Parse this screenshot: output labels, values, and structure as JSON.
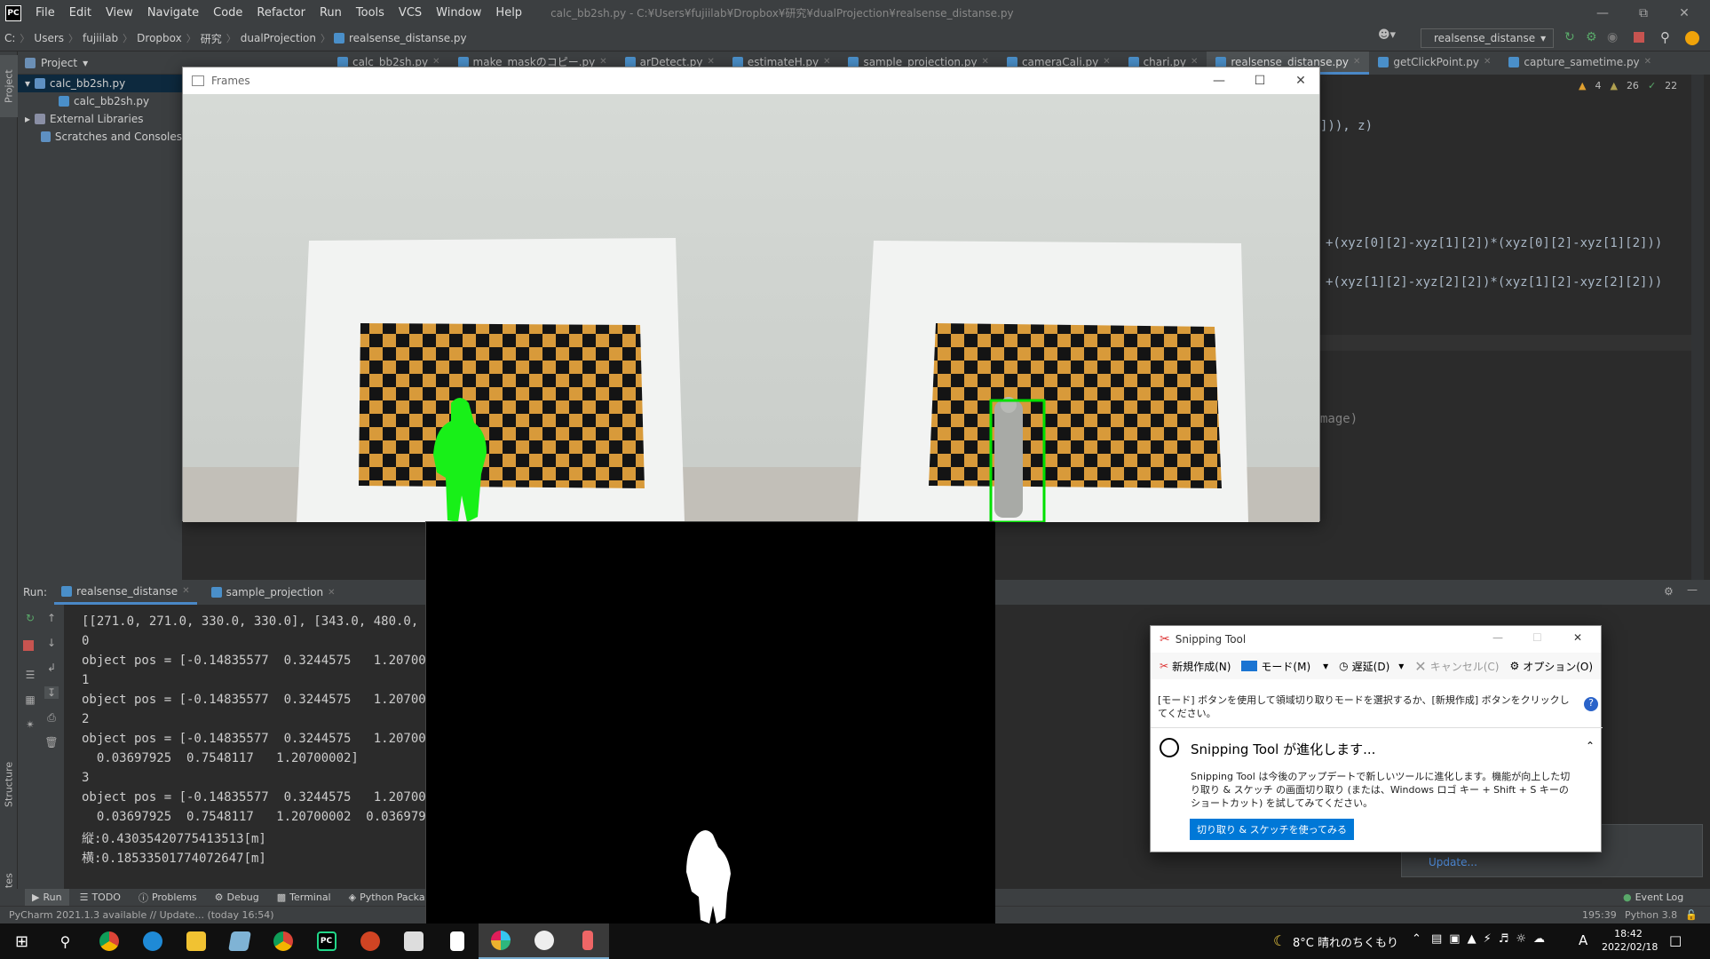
{
  "menubar": {
    "items": [
      "File",
      "Edit",
      "View",
      "Navigate",
      "Code",
      "Refactor",
      "Run",
      "Tools",
      "VCS",
      "Window",
      "Help"
    ],
    "window_title": "calc_bb2sh.py - C:¥Users¥fujiilab¥Dropbox¥研究¥dualProjection¥realsense_distanse.py"
  },
  "navbar": {
    "crumbs": [
      "C:",
      "Users",
      "fujiilab",
      "Dropbox",
      "研究",
      "dualProjection",
      "realsense_distanse.py"
    ],
    "run_config": "realsense_distanse"
  },
  "project": {
    "header": "Project",
    "root": "calc_bb2sh.py",
    "child": "calc_bb2sh.py",
    "ext_libs": "External Libraries",
    "scratches": "Scratches and Consoles"
  },
  "side_tabs": {
    "project": "Project",
    "structure": "Structure",
    "favorites": "Favorites"
  },
  "editor_tabs": [
    "calc_bb2sh.py",
    "make_maskのコピー.py",
    "arDetect.py",
    "estimateH.py",
    "sample_projection.py",
    "cameraCali.py",
    "chari.py",
    "realsense_distanse.py",
    "getClickPoint.py",
    "capture_sametime.py"
  ],
  "active_tab_index": 7,
  "inspections": {
    "warnings": "4",
    "weak": "26",
    "ok": "22"
  },
  "code_fragments": {
    "line1": "])), z)",
    "line2": "+(xyz[0][2]-xyz[1][2])*(xyz[0][2]-xyz[1][2]))",
    "line3": "+(xyz[1][2]-xyz[2][2])*(xyz[1][2]-xyz[2][2]))",
    "line4": "mage)"
  },
  "run": {
    "label": "Run:",
    "tabs": [
      "realsense_distanse",
      "sample_projection"
    ],
    "console": [
      "[[271.0, 271.0, 330.0, 330.0], [343.0, 480.0, 48",
      "0",
      "object pos = [-0.14835577  0.3244575   1.2070000",
      "1",
      "object pos = [-0.14835577  0.3244575   1.2070000",
      "2",
      "object pos = [-0.14835577  0.3244575   1.2070000",
      "  0.03697925  0.7548117   1.20700002]",
      "3",
      "object pos = [-0.14835577  0.3244575   1.2070000",
      "  0.03697925  0.7548117   1.20700002  0.03697925",
      "縦:0.43035420775413513[m]",
      "横:0.18533501774072647[m]"
    ]
  },
  "bottom_tabs": [
    "Run",
    "TODO",
    "Problems",
    "Debug",
    "Terminal",
    "Python Package"
  ],
  "event_log": "Event Log",
  "status": {
    "message": "PyCharm 2021.1.3 available // Update... (today 16:54)",
    "position": "195:39",
    "interpreter": "Python 3.8"
  },
  "update_link": "Update...",
  "frames_window": {
    "title": "Frames"
  },
  "snipping": {
    "title": "Snipping Tool",
    "new": "新規作成(N)",
    "mode": "モード(M)",
    "delay": "遅延(D)",
    "cancel": "キャンセル(C)",
    "options": "オプション(O)",
    "hint": "[モード] ボタンを使用して領域切り取りモードを選択するか、[新規作成] ボタンをクリックしてください。",
    "evolving": "Snipping  Tool が進化します...",
    "body": "Snipping  Tool は今後のアップデートで新しいツールに進化します。機能が向上した切り取り & スケッチ の画面切り取り (または、Windows ロゴ キー + Shift + S キーのショートカット) を試してみてください。",
    "button": "切り取り & スケッチを使ってみる"
  },
  "tray": {
    "weather": "8°C  晴れのちくもり",
    "ime": "A",
    "time": "18:42",
    "date": "2022/02/18"
  },
  "colors": {
    "accent": "#4a88c7",
    "ide_bg": "#2b2b2b",
    "panel": "#3c3f41",
    "green_box": "#00e000",
    "snip_blue": "#0078d7"
  }
}
